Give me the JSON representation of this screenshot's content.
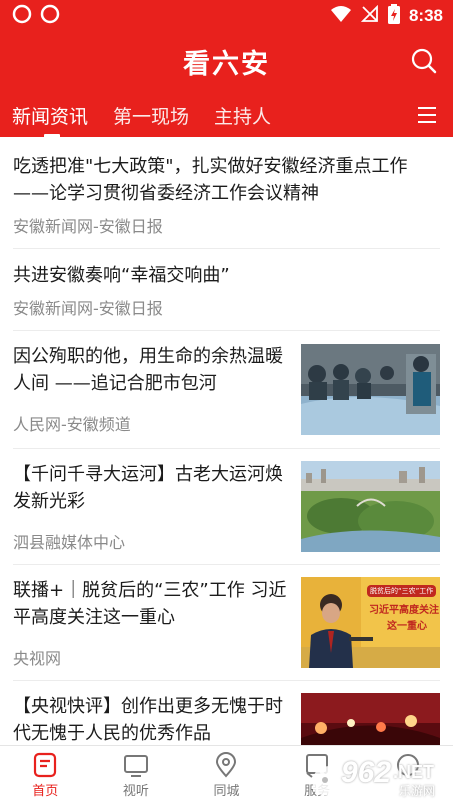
{
  "status": {
    "time": "8:38",
    "icons": [
      "weibo-icon",
      "weibo-icon",
      "wifi-icon",
      "no-signal-icon",
      "battery-charging-icon"
    ]
  },
  "app": {
    "title": "看六安",
    "search_icon": "search-icon",
    "brand_color": "#e8211d"
  },
  "tabs": [
    {
      "label": "新闻资讯",
      "active": true
    },
    {
      "label": "第一现场",
      "active": false
    },
    {
      "label": "主持人",
      "active": false
    }
  ],
  "tabs_menu_icon": "menu-icon",
  "feed": [
    {
      "title": "吃透把准\"七大政策\"，扎实做好安徽经济重点工作 ——论学习贯彻省委经济工作会议精神",
      "source": "安徽新闻网-安徽日报",
      "has_image": false
    },
    {
      "title": "共进安徽奏响“幸福交响曲”",
      "source": "安徽新闻网-安徽日报",
      "has_image": false
    },
    {
      "title": "因公殉职的他，用生命的余热温暖人间 ——追记合肥市包河",
      "source": "人民网-安徽频道",
      "has_image": true
    },
    {
      "title": "【千问千寻大运河】古老大运河焕发新光彩",
      "source": "泗县融媒体中心",
      "has_image": true
    },
    {
      "title": "联播+｜脱贫后的“三农”工作 习近平高度关注这一重心",
      "source": "央视网",
      "has_image": true,
      "image_text": [
        "脱贫后的“三农”工作",
        "习近平高度关注",
        "这一重心"
      ]
    },
    {
      "title": "【央视快评】创作出更多无愧于时代无愧于人民的优秀作品",
      "source": "",
      "has_image": true
    }
  ],
  "bottom_nav": [
    {
      "label": "首页",
      "icon": "home-icon",
      "active": true
    },
    {
      "label": "视听",
      "icon": "tv-icon",
      "active": false
    },
    {
      "label": "同城",
      "icon": "location-pin-icon",
      "active": false
    },
    {
      "label": "服务",
      "icon": "service-icon",
      "active": false
    },
    {
      "label": "",
      "icon": "profile-icon",
      "active": false
    }
  ],
  "watermark": {
    "text": "962",
    "suffix": ".NET",
    "subtext": "乐游网"
  }
}
